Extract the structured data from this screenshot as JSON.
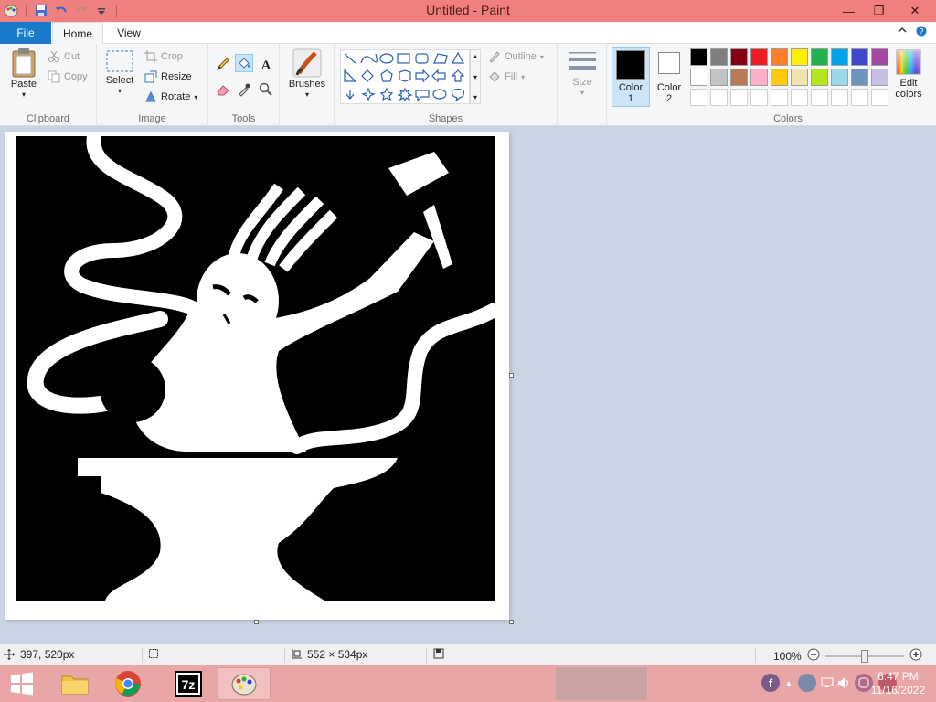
{
  "window": {
    "title": "Untitled - Paint",
    "controls": {
      "minimize": "—",
      "restore": "❐",
      "close": "✕"
    }
  },
  "tabs": [
    {
      "label": "File"
    },
    {
      "label": "Home"
    },
    {
      "label": "View"
    }
  ],
  "ribbon": {
    "clipboard": {
      "label": "Clipboard",
      "paste": "Paste",
      "cut": "Cut",
      "copy": "Copy"
    },
    "image": {
      "label": "Image",
      "select": "Select",
      "crop": "Crop",
      "resize": "Resize",
      "rotate": "Rotate"
    },
    "tools": {
      "label": "Tools"
    },
    "brushes": {
      "label": "Brushes"
    },
    "shapes": {
      "label": "Shapes",
      "outline": "Outline",
      "fill": "Fill"
    },
    "size": {
      "label": "Size"
    },
    "color1": {
      "label_line1": "Color",
      "label_line2": "1",
      "value": "#000000"
    },
    "color2": {
      "label_line1": "Color",
      "label_line2": "2",
      "value": "#ffffff"
    },
    "colors": {
      "label": "Colors",
      "row1": [
        "#000000",
        "#7f7f7f",
        "#880015",
        "#ed1c24",
        "#ff7f27",
        "#fff200",
        "#22b14c",
        "#00a2e8",
        "#3f48cc",
        "#a349a4"
      ],
      "row2": [
        "#ffffff",
        "#c3c3c3",
        "#b97a57",
        "#ffaec9",
        "#ffc90e",
        "#efe4b0",
        "#b5e61d",
        "#99d9ea",
        "#7092be",
        "#c8bfe7"
      ]
    },
    "edit_colors": {
      "line1": "Edit",
      "line2": "colors"
    }
  },
  "statusbar": {
    "cursor_pos": "397, 520px",
    "image_size": "552 × 534px",
    "zoom": "100%"
  },
  "taskbar": {
    "time": "6:47 PM",
    "date": "11/16/2022",
    "apps": [
      "File Explorer",
      "Google Chrome",
      "7-Zip",
      "Paint"
    ]
  }
}
